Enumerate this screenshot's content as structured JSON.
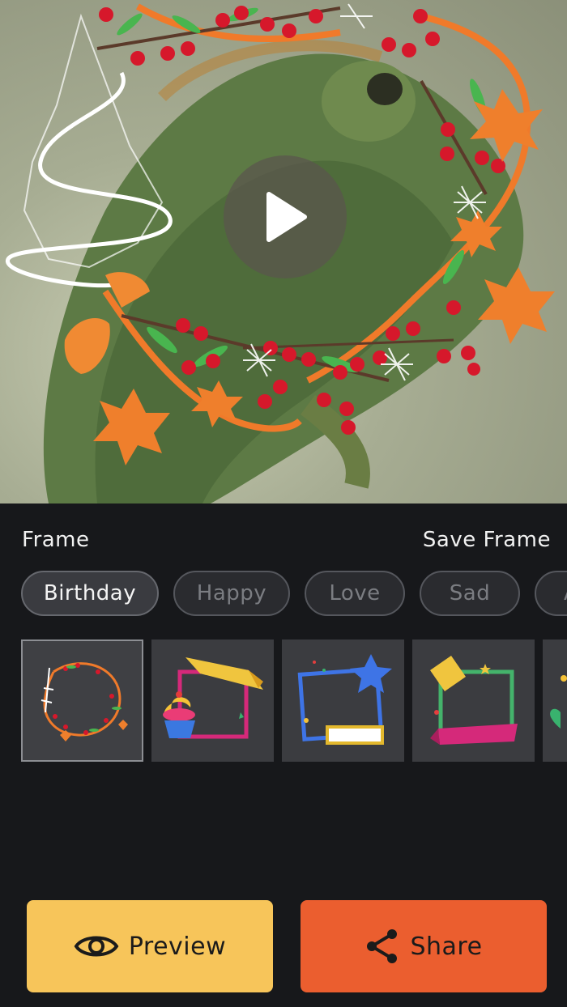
{
  "preview": {
    "play_icon": "play-icon"
  },
  "frame_panel": {
    "title": "Frame",
    "save_label": "Save Frame",
    "categories": [
      {
        "label": "Birthday",
        "active": true
      },
      {
        "label": "Happy",
        "active": false
      },
      {
        "label": "Love",
        "active": false
      },
      {
        "label": "Sad",
        "active": false
      },
      {
        "label": "A",
        "active": false
      }
    ],
    "frames": [
      {
        "name": "christmas-wreath-frame",
        "selected": true
      },
      {
        "name": "birthday-cupcake-frame",
        "selected": false
      },
      {
        "name": "star-frame",
        "selected": false
      },
      {
        "name": "ribbon-frame",
        "selected": false
      },
      {
        "name": "partial-frame",
        "selected": false
      }
    ]
  },
  "actions": {
    "preview_label": "Preview",
    "preview_icon": "eye-icon",
    "share_label": "Share",
    "share_icon": "share-icon"
  },
  "colors": {
    "background": "#17181b",
    "preview_button": "#f7c55a",
    "share_button": "#eb5e2f",
    "frame_orange": "#f07a2a",
    "berry_red": "#d6182b",
    "leaf_green": "#49b54f"
  }
}
